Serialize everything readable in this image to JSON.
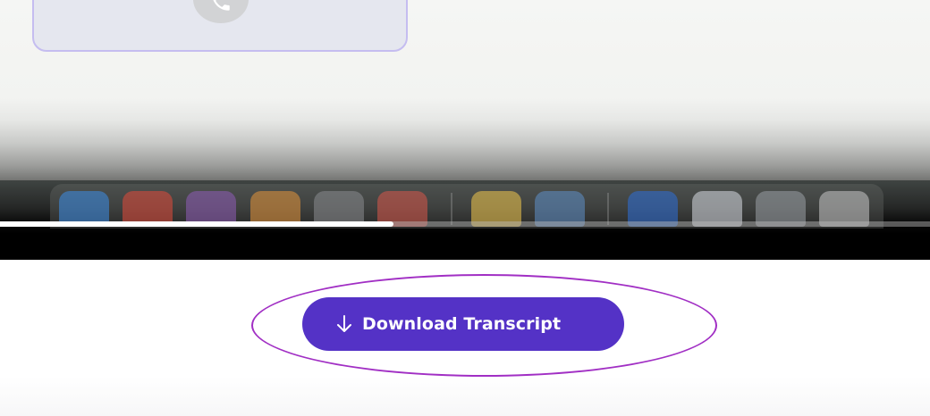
{
  "player": {
    "progress_fraction": 0.423,
    "call_icon": "phone-icon",
    "dock_icons": [
      {
        "name": "finder-icon",
        "color": "#3d8ee8"
      },
      {
        "name": "chrome-icon",
        "color": "#e24b3b"
      },
      {
        "name": "slack-icon",
        "color": "#8f5db8"
      },
      {
        "name": "browser-icon",
        "color": "#e6953a"
      },
      {
        "name": "settings-icon",
        "color": "#8a8d90"
      },
      {
        "name": "phone-mirror-icon",
        "color": "#d8574a"
      },
      {
        "name": "notes-icon",
        "color": "#f2c94c"
      },
      {
        "name": "preview-icon",
        "color": "#5f8fc9"
      },
      {
        "name": "password-manager-icon",
        "color": "#2e6fd8"
      },
      {
        "name": "document-icon",
        "color": "#d9dde3"
      },
      {
        "name": "window-icon",
        "color": "#9aa0a6"
      },
      {
        "name": "trash-icon",
        "color": "#c8c8c8"
      }
    ]
  },
  "download": {
    "label": "Download Transcript",
    "icon": "arrow-down-icon"
  },
  "colors": {
    "button_bg": "#5432c6",
    "highlight_ring": "#a12fc4",
    "progress_fill": "#ffffff"
  }
}
